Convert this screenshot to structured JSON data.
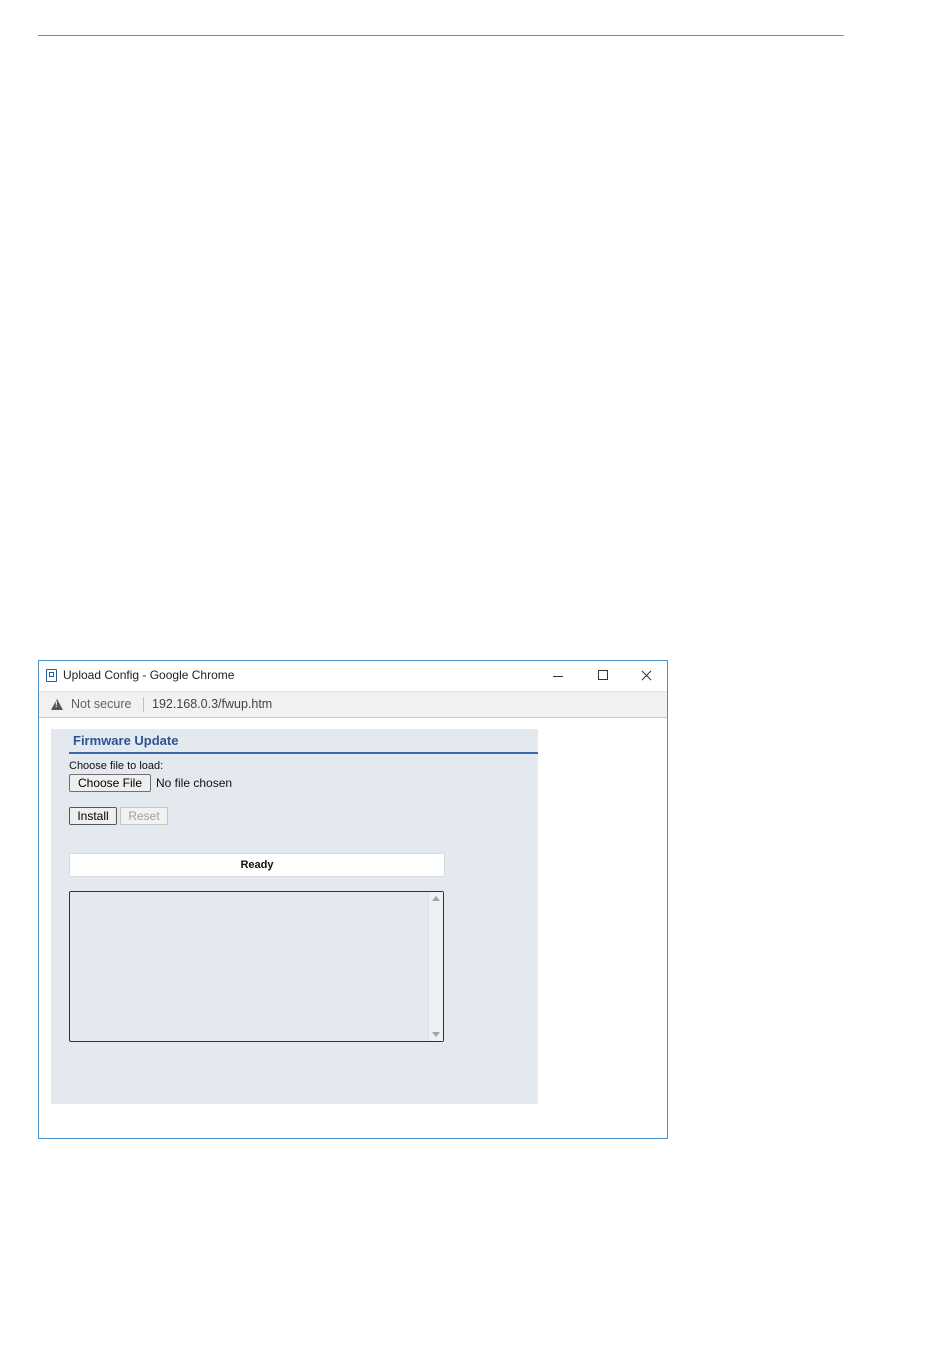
{
  "window": {
    "title": "Upload Config - Google Chrome",
    "app_icon": "document-icon",
    "controls": [
      "minimize",
      "maximize",
      "close"
    ]
  },
  "address_bar": {
    "security_icon": "warning-icon",
    "security_label": "Not secure",
    "url": "192.168.0.3/fwup.htm"
  },
  "page": {
    "heading": "Firmware Update",
    "file_label": "Choose file to load:",
    "choose_file_label": "Choose File",
    "file_status": "No file chosen",
    "install_label": "Install",
    "reset_label": "Reset",
    "status_text": "Ready",
    "log_text": ""
  },
  "colors": {
    "window_border": "#4a90c8",
    "panel_background": "#e4e9f0",
    "heading_text": "#2a5590",
    "heading_rule": "#3a6aaa",
    "disabled_text": "#a0a0a0"
  }
}
